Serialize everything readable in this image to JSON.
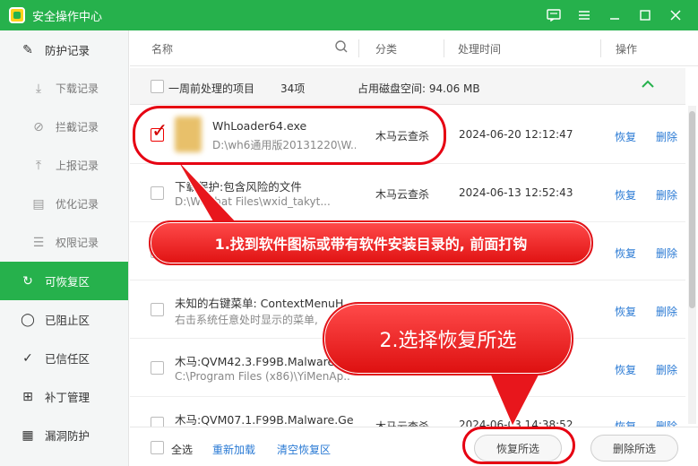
{
  "app": {
    "title": "安全操作中心"
  },
  "sidebar": {
    "items": [
      {
        "label": "防护记录",
        "icon": "edit-icon",
        "sub": false
      },
      {
        "label": "下载记录",
        "icon": "download-icon",
        "sub": true
      },
      {
        "label": "拦截记录",
        "icon": "block-icon",
        "sub": true
      },
      {
        "label": "上报记录",
        "icon": "upload-icon",
        "sub": true
      },
      {
        "label": "优化记录",
        "icon": "clipboard-icon",
        "sub": true
      },
      {
        "label": "权限记录",
        "icon": "sliders-icon",
        "sub": true
      },
      {
        "label": "可恢复区",
        "icon": "restore-icon",
        "sub": false,
        "active": true
      },
      {
        "label": "已阻止区",
        "icon": "shield-block-icon",
        "sub": false
      },
      {
        "label": "已信任区",
        "icon": "shield-check-icon",
        "sub": false
      },
      {
        "label": "补丁管理",
        "icon": "grid-icon",
        "sub": false
      },
      {
        "label": "漏洞防护",
        "icon": "patch-icon",
        "sub": false
      }
    ]
  },
  "table": {
    "headers": {
      "name": "名称",
      "category": "分类",
      "time": "处理时间",
      "action": "操作"
    },
    "group": {
      "label": "一周前处理的项目",
      "count": "34项",
      "disk_label": "占用磁盘空间: 94.06 MB"
    },
    "rows": [
      {
        "name": "WhLoader64.exe",
        "path": "D:\\wh6通用版20131220\\W...",
        "category": "木马云查杀",
        "time": "2024-06-20 12:12:47",
        "restore": "恢复",
        "delete": "删除",
        "checked": true
      },
      {
        "name": "下载保护:包含风险的文件",
        "path": "D:\\WeChat Files\\wxid_takyt...",
        "category": "木马云查杀",
        "time": "2024-06-13 12:52:43",
        "restore": "恢复",
        "delete": "删除",
        "checked": false
      },
      {
        "name": "",
        "path": "",
        "category": "",
        "time": "",
        "restore": "恢复",
        "delete": "删除",
        "checked": false
      },
      {
        "name": "未知的右键菜单: ContextMenuH...",
        "path": "右击系统任意处时显示的菜单,",
        "category": "",
        "time": "",
        "restore": "恢复",
        "delete": "删除",
        "checked": false
      },
      {
        "name": "木马:QVM42.3.F99B.Malware...",
        "path": "C:\\Program Files (x86)\\YiMenAp...",
        "category": "",
        "time": "",
        "restore": "恢复",
        "delete": "删除",
        "checked": false
      },
      {
        "name": "木马:QVM07.1.F99B.Malware.Gen",
        "path": "",
        "category": "木马云查杀",
        "time": "2024-06-03 14:38:52",
        "restore": "恢复",
        "delete": "删除",
        "checked": false
      }
    ]
  },
  "footer": {
    "select_all": "全选",
    "reload": "重新加载",
    "clear": "清空恢复区",
    "restore_selected": "恢复所选",
    "delete_selected": "删除所选"
  },
  "annotations": {
    "step1": "1.找到软件图标或带有软件安装目录的, 前面打钩",
    "step2": "2.选择恢复所选"
  },
  "colors": {
    "brand": "#26b14c",
    "link": "#2a7ad4",
    "annotation_red": "#e60012"
  }
}
